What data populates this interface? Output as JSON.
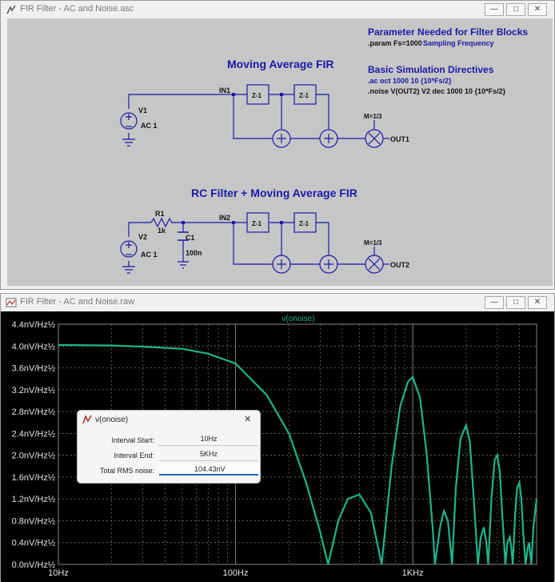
{
  "schematic_window": {
    "title": "FIR Filter - AC and Noise.asc",
    "buttons": {
      "minimize": "—",
      "restore": "□",
      "close": "✕"
    },
    "heading_params": "Parameter Needed for Filter Blocks",
    "param_directive": ".param Fs=1000",
    "param_comment": "Sampling Frequency",
    "heading_sim": "Basic Simulation Directives",
    "ac_directive": ".ac oct 1000 10 {10*Fs/2}",
    "noise_directive": ".noise V(OUT2) V2 dec 1000 10 {10*Fs/2}",
    "circuit1": {
      "title": "Moving Average FIR",
      "source_name": "V1",
      "source_value": "AC 1",
      "input_net": "IN1",
      "delay1": "Z-1",
      "delay2": "Z-1",
      "multiplier_param": "M=1/3",
      "output_net": "OUT1"
    },
    "circuit2": {
      "title": "RC Filter + Moving Average FIR",
      "source_name": "V2",
      "source_value": "AC 1",
      "resistor_name": "R1",
      "resistor_value": "1k",
      "capacitor_name": "C1",
      "capacitor_value": "100n",
      "input_net": "IN2",
      "delay1": "Z-1",
      "delay2": "Z-1",
      "multiplier_param": "M=1/3",
      "output_net": "OUT2"
    },
    "colors": {
      "background": "#c6c6c6",
      "wire": "#1a1aa8",
      "heading": "#1a1aa8"
    }
  },
  "plot_window": {
    "title": "FIR Filter - AC and Noise.raw",
    "buttons": {
      "minimize": "—",
      "restore": "□",
      "close": "✕"
    }
  },
  "chart_data": {
    "type": "line",
    "title": "",
    "trace_label": "v(onoise)",
    "x_scale": "log",
    "xlim": [
      10,
      5000
    ],
    "ylim": [
      0,
      4.4
    ],
    "x_ticks": [
      "10Hz",
      "100Hz",
      "1KHz"
    ],
    "x_tick_values": [
      10,
      100,
      1000
    ],
    "y_ticks": [
      "0.0nV/Hz½",
      "0.4nV/Hz½",
      "0.8nV/Hz½",
      "1.2nV/Hz½",
      "1.6nV/Hz½",
      "2.0nV/Hz½",
      "2.4nV/Hz½",
      "2.8nV/Hz½",
      "3.2nV/Hz½",
      "3.6nV/Hz½",
      "4.0nV/Hz½",
      "4.4nV/Hz½"
    ],
    "y_tick_values": [
      0,
      0.4,
      0.8,
      1.2,
      1.6,
      2.0,
      2.4,
      2.8,
      3.2,
      3.6,
      4.0,
      4.4
    ],
    "grid": true,
    "series": [
      {
        "name": "v(onoise)",
        "color": "#1fb58a",
        "x": [
          10,
          20,
          30,
          50,
          70,
          100,
          150,
          200,
          250,
          300,
          333,
          380,
          430,
          500,
          580,
          667,
          760,
          850,
          940,
          1000,
          1100,
          1200,
          1300,
          1333,
          1430,
          1500,
          1580,
          1667,
          1750,
          1860,
          2000,
          2100,
          2200,
          2333,
          2420,
          2520,
          2600,
          2667,
          2780,
          2900,
          3000,
          3100,
          3200,
          3333,
          3420,
          3530,
          3600,
          3667,
          3780,
          3880,
          4000,
          4100,
          4200,
          4333,
          4450,
          4540,
          4667,
          4800,
          5000
        ],
        "y": [
          4.02,
          4.01,
          3.99,
          3.95,
          3.86,
          3.68,
          3.1,
          2.4,
          1.5,
          0.6,
          0.0,
          0.8,
          1.2,
          1.28,
          0.95,
          0.0,
          1.8,
          2.9,
          3.35,
          3.43,
          3.05,
          2.0,
          0.6,
          0.0,
          0.7,
          0.98,
          0.8,
          0.0,
          1.4,
          2.3,
          2.55,
          2.25,
          1.3,
          0.0,
          0.5,
          0.68,
          0.4,
          0.0,
          1.2,
          1.92,
          2.0,
          1.7,
          0.9,
          0.0,
          0.4,
          0.5,
          0.3,
          0.0,
          0.9,
          1.4,
          1.5,
          1.2,
          0.6,
          0.0,
          0.3,
          0.4,
          0.0,
          0.7,
          1.2
        ]
      }
    ]
  },
  "measurement_dialog": {
    "title": "v(onoise)",
    "close_glyph": "✕",
    "rows": [
      {
        "label": "Interval Start:",
        "value": "10Hz"
      },
      {
        "label": "Interval End:",
        "value": "5KHz"
      },
      {
        "label": "Total RMS noise:",
        "value": "104.43nV"
      }
    ]
  }
}
